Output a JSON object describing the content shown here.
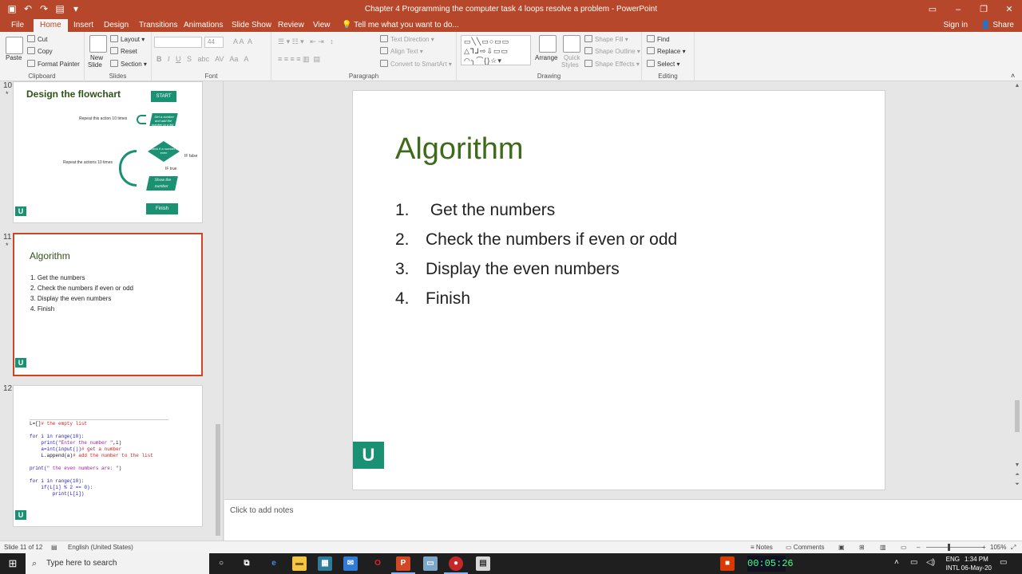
{
  "window": {
    "title": "Chapter 4 Programming the computer task 4 loops resolve a problem - PowerPoint"
  },
  "tabs": [
    "File",
    "Home",
    "Insert",
    "Design",
    "Transitions",
    "Animations",
    "Slide Show",
    "Review",
    "View"
  ],
  "active_tab": "Home",
  "tell_me": "Tell me what you want to do...",
  "account": {
    "signin": "Sign in",
    "share": "Share"
  },
  "ribbon": {
    "clipboard": {
      "label": "Clipboard",
      "paste": "Paste",
      "cut": "Cut",
      "copy": "Copy",
      "format_painter": "Format Painter"
    },
    "slides": {
      "label": "Slides",
      "new_slide_1": "New",
      "new_slide_2": "Slide",
      "layout": "Layout",
      "reset": "Reset",
      "section": "Section"
    },
    "font": {
      "label": "Font",
      "size": "44"
    },
    "paragraph": {
      "label": "Paragraph",
      "text_direction": "Text Direction",
      "align_text": "Align Text",
      "smartart": "Convert to SmartArt"
    },
    "drawing": {
      "label": "Drawing",
      "arrange": "Arrange",
      "quick_styles_1": "Quick",
      "quick_styles_2": "Styles",
      "shape_fill": "Shape Fill",
      "shape_outline": "Shape Outline",
      "shape_effects": "Shape Effects"
    },
    "editing": {
      "label": "Editing",
      "find": "Find",
      "replace": "Replace",
      "select": "Select"
    }
  },
  "thumbnails": {
    "s10": {
      "num": "10",
      "title": "Design the flowchart",
      "start": "START",
      "step1": "Get a number and add the number to a list",
      "repeat1": "Repeat this action 10 times",
      "decision": "Check if a number is even",
      "if_false": "IF false",
      "if_true": "IF true",
      "repeat2": "Repeat the actions 10 times",
      "show": "Show the number",
      "finish": "Finish"
    },
    "s11": {
      "num": "11",
      "title": "Algorithm",
      "items": [
        "1.    Get the numbers",
        "2.   Check the numbers if even or odd",
        "3.   Display the even numbers",
        "4.   Finish"
      ]
    },
    "s12": {
      "num": "12",
      "code": {
        "l1a": "L=[]",
        "l1b": "# the empty list",
        "l2": "for i in range(10):",
        "l3a": "    print(",
        "l3b": "\"Enter the number \"",
        "l3c": ",i)",
        "l4a": "    a=int(input())",
        "l4b": "# get a number",
        "l5a": "    L.append(a)",
        "l5b": "# add the number to the list",
        "l6a": "print(",
        "l6b": "\" the even numbers are: \"",
        "l6c": ")",
        "l7": "for i in range(10):",
        "l8": "    if(L[i] % 2 == 0):",
        "l9": "        print(L[i])"
      }
    }
  },
  "slide": {
    "title": "Algorithm",
    "items": [
      {
        "n": "1.",
        "text": " Get the numbers"
      },
      {
        "n": "2.",
        "text": "Check the numbers if even or odd"
      },
      {
        "n": "3.",
        "text": "Display the even numbers"
      },
      {
        "n": "4.",
        "text": "Finish"
      }
    ],
    "logo": "U"
  },
  "notes_placeholder": "Click to add notes",
  "status": {
    "slide_info": "Slide 11 of 12",
    "language": "English (United States)",
    "notes": "Notes",
    "comments": "Comments",
    "zoom": "105%"
  },
  "taskbar": {
    "search_placeholder": "Type here to search",
    "stopwatch": "00:05:26",
    "lang1": "ENG",
    "lang2": "INTL",
    "time": "1:34 PM",
    "date": "06-May-20"
  },
  "colors": {
    "accent": "#b7472a",
    "title_green": "#3d6b1a",
    "logo_green": "#1b9174"
  }
}
